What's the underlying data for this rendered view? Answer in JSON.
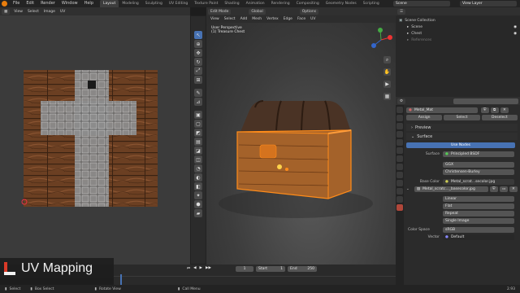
{
  "menu": {
    "file": "File",
    "edit": "Edit",
    "render": "Render",
    "window": "Window",
    "help": "Help"
  },
  "workspaces": [
    "Layout",
    "Modeling",
    "Sculpting",
    "UV Editing",
    "Texture Paint",
    "Shading",
    "Animation",
    "Rendering",
    "Compositing",
    "Geometry Nodes",
    "Scripting"
  ],
  "top_right": {
    "scene": "Scene",
    "view_layer": "View Layer"
  },
  "uv_header": {
    "view": "View",
    "select": "Select",
    "image": "Image",
    "uv": "UV"
  },
  "viewport_header": {
    "mode": "Edit Mode",
    "orientation": "Global",
    "options": "Options"
  },
  "viewport_menu": [
    "View",
    "Select",
    "Add",
    "Mesh",
    "Vertex",
    "Edge",
    "Face",
    "UV"
  ],
  "viewport_info": {
    "line1": "User Perspective",
    "line2": "(1) Treasure Chest"
  },
  "outliner": {
    "root": "Scene Collection",
    "items": [
      {
        "name": "Scene"
      },
      {
        "name": "Chest"
      },
      {
        "name": "References"
      }
    ]
  },
  "properties": {
    "material": "Metal_Mat",
    "assign": "Assign",
    "select": "Select",
    "deselect": "Deselect",
    "preview": "Preview",
    "surface_section": "Surface",
    "use_nodes": "Use Nodes",
    "surface_label": "Surface",
    "surface_value": "Principled BSDF",
    "distribution": "GGX",
    "subsurface": "Christensen-Burley",
    "base_color_label": "Base Color",
    "base_color_value": "Metal_scrat...secolor.jpg",
    "image_name": "Metal_scratc..._basecolor.jpg",
    "interpolation": "Linear",
    "projection": "Flat",
    "extension": "Repeat",
    "source": "Single Image",
    "colorspace_label": "Color Space",
    "colorspace_value": "sRGB",
    "vector_label": "Vector",
    "vector_value": "Default"
  },
  "timeline": {
    "frame": "1",
    "start_label": "Start",
    "start": "1",
    "end_label": "End",
    "end": "250"
  },
  "caption": "UV Mapping",
  "status": {
    "select": "Select",
    "box_select": "Box Select",
    "rotate": "Rotate View",
    "call_menu": "Call Menu",
    "version": "2.93"
  },
  "colors": {
    "accent": "#4772b3",
    "selection": "#ff8c1a",
    "blender_orange": "#e87d0d",
    "caption_red": "#d93a28"
  }
}
